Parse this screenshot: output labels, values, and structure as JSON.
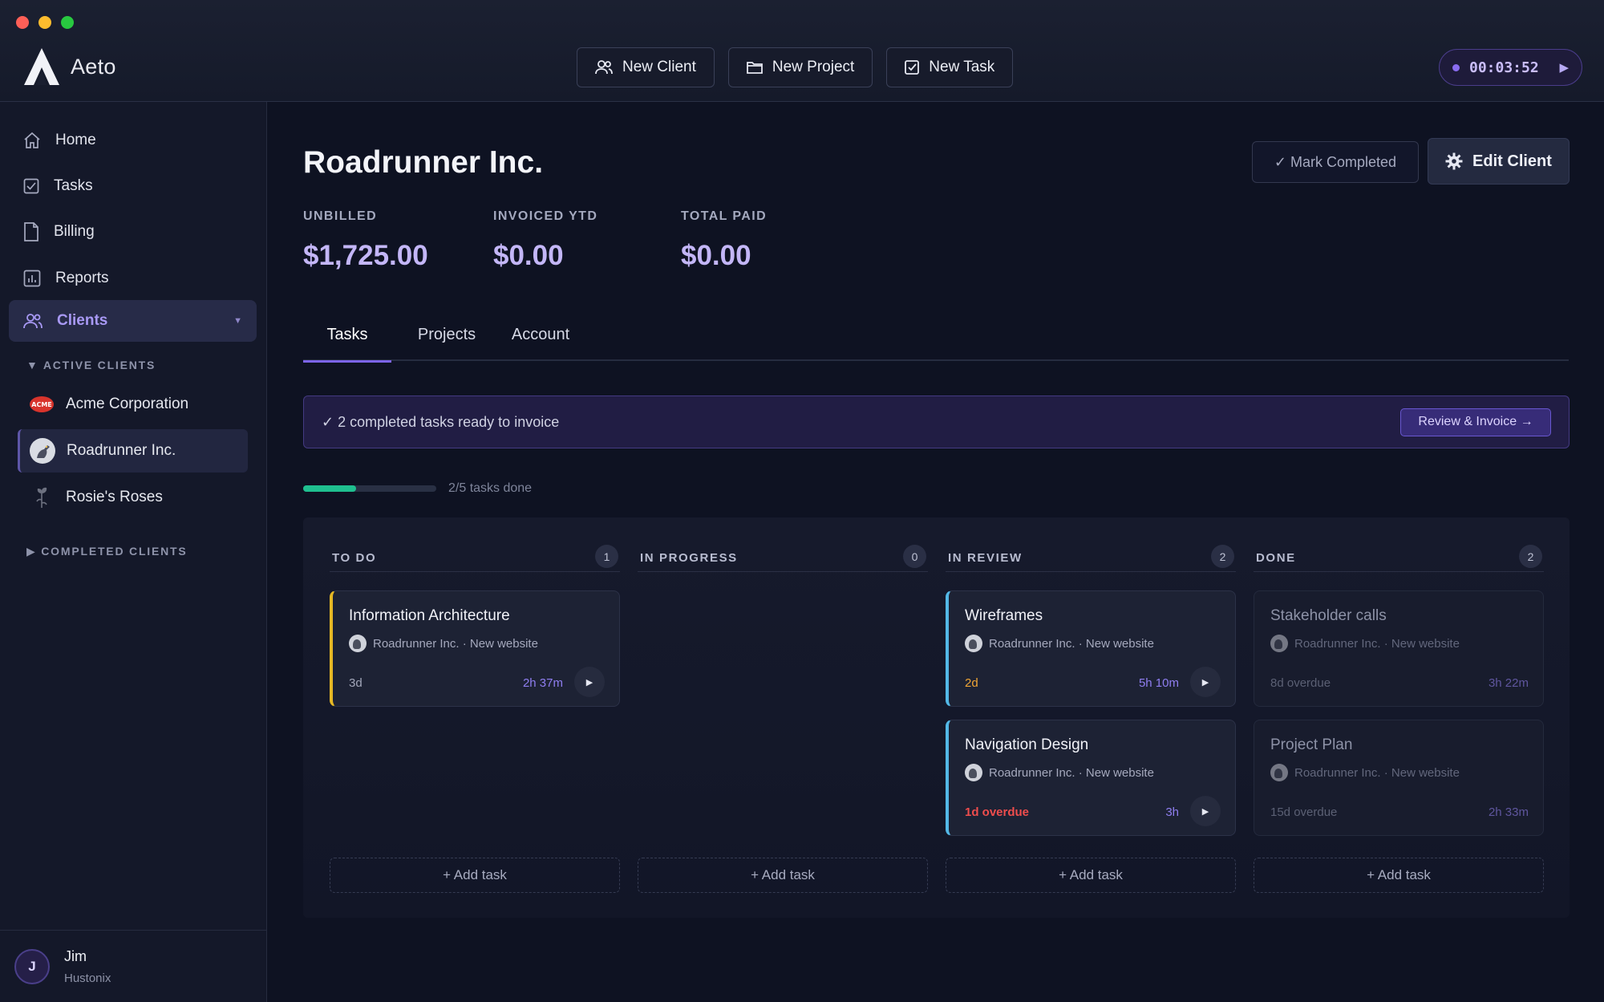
{
  "app": {
    "name": "Aeto"
  },
  "header": {
    "buttons": [
      {
        "label": "New Client",
        "icon": "users-icon"
      },
      {
        "label": "New Project",
        "icon": "folder-icon"
      },
      {
        "label": "New Task",
        "icon": "checkbox-icon"
      }
    ],
    "timer": {
      "value": "00:03:52"
    }
  },
  "sidebar": {
    "nav": [
      {
        "label": "Home",
        "icon": "home-icon"
      },
      {
        "label": "Tasks",
        "icon": "checkbox-icon"
      },
      {
        "label": "Billing",
        "icon": "document-icon"
      },
      {
        "label": "Reports",
        "icon": "bar-chart-icon"
      },
      {
        "label": "Clients",
        "icon": "users-icon",
        "active": true
      }
    ],
    "active_clients_label": "ACTIVE CLIENTS",
    "clients": [
      {
        "name": "Acme Corporation"
      },
      {
        "name": "Roadrunner Inc.",
        "active": true
      },
      {
        "name": "Rosie's Roses"
      }
    ],
    "completed_clients_label": "COMPLETED CLIENTS",
    "user": {
      "initial": "J",
      "name": "Jim",
      "org": "Hustonix"
    }
  },
  "main": {
    "title": "Roadrunner Inc.",
    "mark_completed": "✓ Mark Completed",
    "edit_client": "Edit Client",
    "stats": [
      {
        "label": "UNBILLED",
        "value": "$1,725.00"
      },
      {
        "label": "INVOICED YTD",
        "value": "$0.00"
      },
      {
        "label": "TOTAL PAID",
        "value": "$0.00"
      }
    ],
    "tabs": [
      {
        "label": "Tasks",
        "active": true
      },
      {
        "label": "Projects"
      },
      {
        "label": "Account"
      }
    ],
    "banner": {
      "text": "✓ 2 completed tasks ready to invoice",
      "button": "Review & Invoice →"
    },
    "progress": {
      "done": 2,
      "total": 5,
      "fraction": 0.4,
      "label": "2/5 tasks done"
    },
    "add_task_label": "+ Add task",
    "columns": [
      {
        "title": "TO DO",
        "count": "1",
        "cards": [
          {
            "title": "Information Architecture",
            "sub": "Roadrunner Inc. · New website",
            "due": "3d",
            "time": "2h 37m"
          }
        ]
      },
      {
        "title": "IN PROGRESS",
        "count": "0",
        "cards": []
      },
      {
        "title": "IN REVIEW",
        "count": "2",
        "cards": [
          {
            "title": "Wireframes",
            "sub": "Roadrunner Inc. · New website",
            "due": "2d",
            "time": "5h 10m"
          },
          {
            "title": "Navigation Design",
            "sub": "Roadrunner Inc. · New website",
            "due": "1d overdue",
            "time": "3h"
          }
        ]
      },
      {
        "title": "DONE",
        "count": "2",
        "cards": [
          {
            "title": "Stakeholder calls",
            "sub": "Roadrunner Inc. · New website",
            "due": "8d overdue",
            "time": "3h 22m"
          },
          {
            "title": "Project Plan",
            "sub": "Roadrunner Inc. · New website",
            "due": "15d overdue",
            "time": "2h 33m"
          }
        ]
      }
    ]
  },
  "colors": {
    "accent": "#7c64e8",
    "progress": "#1fbf8f",
    "todo_border": "#e6b824",
    "review_border": "#53b8e6",
    "overdue": "#ef4d4d",
    "due_soon": "#f0a535"
  }
}
